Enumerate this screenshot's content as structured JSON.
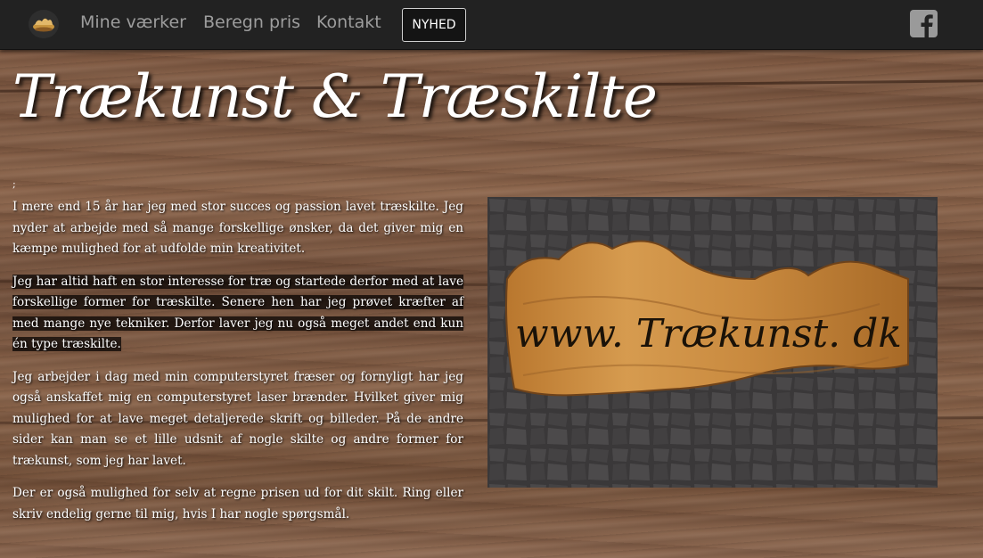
{
  "nav": {
    "logo_icon": "wood-logo-icon",
    "links": [
      "Mine værker",
      "Beregn pris",
      "Kontakt"
    ],
    "highlight_button": "NYHED",
    "social_icon": "facebook-icon"
  },
  "header": {
    "title": "Trækunst & Træskilte"
  },
  "content": {
    "stray_char": ";",
    "paragraphs": [
      "I mere end 15 år har jeg med stor succes og passion lavet træskilte. Jeg nyder at arbejde med så mange forskellige ønsker, da det giver mig en kæmpe mulighed for at udfolde min kreativitet.",
      "Jeg har altid haft en stor interesse for træ og startede derfor med at lave forskellige former for træskilte. Senere hen har jeg prøvet kræfter af med mange nye tekniker. Derfor laver jeg nu også meget andet end kun én type træskilte.",
      "Jeg arbejder i dag med min computerstyret fræser og fornyligt har jeg også anskaffet mig en computerstyret laser brænder. Hvilket giver mig mulighed for at lave meget detaljerede skrift og billeder. På de andre sider kan man se et lille udsnit af nogle skilte og andre former for trækunst, som jeg har lavet.",
      "Der er også mulighed for selv at regne prisen ud for dit skilt. Ring eller skriv endelig gerne til mig, hvis I har nogle spørgsmål."
    ],
    "highlighted_line": "Jeg har altid haft en stor interesse for træ og startede derfor med at lave"
  },
  "photo": {
    "sign_text": "www. Trækunst. dk"
  },
  "colors": {
    "navbar": "#222222",
    "nav_link": "#9d9d9d",
    "text": "#ffffff",
    "wood": "#7a5640"
  }
}
